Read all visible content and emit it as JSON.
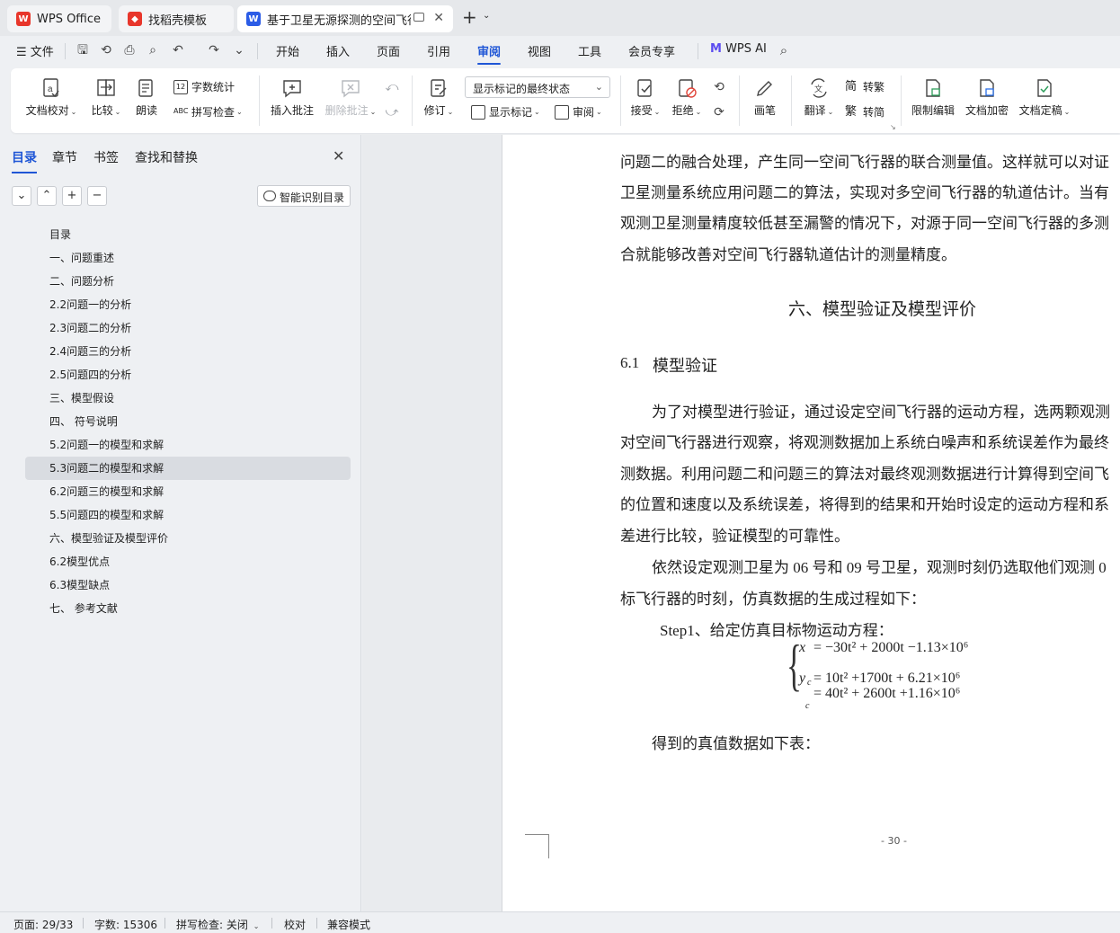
{
  "tabs": [
    {
      "label": "WPS Office",
      "icon": "wps-logo-icon",
      "color": "#e8362b"
    },
    {
      "label": "找稻壳模板",
      "icon": "docer-logo-icon",
      "color": "#e8362b"
    },
    {
      "label": "基于卫星无源探测的空间飞行器",
      "icon": "wps-writer-icon",
      "color": "#2b5ce6"
    }
  ],
  "menu": {
    "file": "文件",
    "items": [
      "开始",
      "插入",
      "页面",
      "引用",
      "审阅",
      "视图",
      "工具",
      "会员专享"
    ],
    "active": "审阅",
    "ai": "WPS AI"
  },
  "ribbon": {
    "proofread": "文档校对",
    "compare": "比较",
    "read_aloud": "朗读",
    "word_count": "字数统计",
    "spell_check": "拼写检查",
    "insert_comment": "插入批注",
    "delete_comment": "删除批注",
    "revise": "修订",
    "markup_dropdown": "显示标记的最终状态",
    "show_markup": "显示标记",
    "review": "审阅",
    "accept": "接受",
    "reject": "拒绝",
    "pen": "画笔",
    "translate": "翻译",
    "to_traditional": "转繁",
    "to_simplified": "转简",
    "restrict_edit": "限制编辑",
    "encrypt": "文档加密",
    "finalize": "文档定稿"
  },
  "sidebar": {
    "tabs": [
      "目录",
      "章节",
      "书签",
      "查找和替换"
    ],
    "smart_toc": "智能识别目录",
    "toc": [
      "目录",
      "一、问题重述",
      "二、问题分析",
      "2.2问题一的分析",
      "2.3问题二的分析",
      "2.4问题三的分析",
      "2.5问题四的分析",
      "三、模型假设",
      "四、 符号说明",
      "5.2问题一的模型和求解",
      "5.3问题二的模型和求解",
      "6.2问题三的模型和求解",
      "5.5问题四的模型和求解",
      "六、模型验证及模型评价",
      "6.2模型优点",
      "6.3模型缺点",
      "七、 参考文献"
    ],
    "active_index": 10
  },
  "document": {
    "p1": [
      "问题二的融合处理，产生同一空间飞行器的联合测量值。这样就可以对证",
      "卫星测量系统应用问题二的算法，实现对多空间飞行器的轨道估计。当有",
      "观测卫星测量精度较低甚至漏警的情况下，对源于同一空间飞行器的多测",
      "合就能够改善对空间飞行器轨道估计的测量精度。"
    ],
    "heading": "六、模型验证及模型评价",
    "subheading_num": "6.1",
    "subheading": "模型验证",
    "p2": [
      "为了对模型进行验证，通过设定空间飞行器的运动方程，选两颗观测",
      "对空间飞行器进行观察，将观测数据加上系统白噪声和系统误差作为最终",
      "测数据。利用问题二和问题三的算法对最终观测数据进行计算得到空间飞",
      "的位置和速度以及系统误差，将得到的结果和开始时设定的运动方程和系",
      "差进行比较，验证模型的可靠性。"
    ],
    "p3": [
      "依然设定观测卫星为 06 号和 09 号卫星，观测时刻仍选取他们观测 0",
      "标飞行器的时刻，仿真数据的生成过程如下："
    ],
    "step1": "Step1、给定仿真目标物运动方程：",
    "eq1": "x",
    "eq1_rhs": "= −30t² + 2000t −1.13×10⁶",
    "eq2": "y",
    "eq2_rhs": "= 10t² +1700t + 6.21×10⁶",
    "eq3_rhs": "= 40t² + 2600t +1.16×10⁶",
    "eq_sub": "c",
    "p4": "得到的真值数据如下表：",
    "page_number": "- 30 -"
  },
  "status": {
    "page": "页面: 29/33",
    "words": "字数: 15306",
    "spell": "拼写检查: 关闭",
    "proof": "校对",
    "compat": "兼容模式"
  }
}
